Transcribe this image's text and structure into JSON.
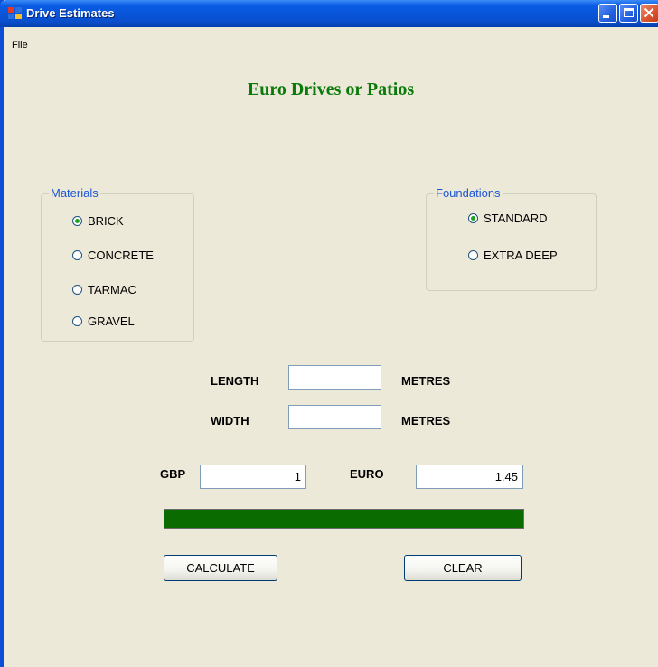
{
  "window": {
    "title": "Drive Estimates",
    "accent": "#0853d6"
  },
  "menu": {
    "file": "File"
  },
  "heading": "Euro Drives or Patios",
  "materials": {
    "legend": "Materials",
    "options": [
      "BRICK",
      "CONCRETE",
      "TARMAC",
      "GRAVEL"
    ],
    "selected": "BRICK"
  },
  "foundations": {
    "legend": "Foundations",
    "options": [
      "STANDARD",
      "EXTRA DEEP"
    ],
    "selected": "STANDARD"
  },
  "dimensions": {
    "length_label": "LENGTH",
    "length_value": "",
    "length_unit": "METRES",
    "width_label": "WIDTH",
    "width_value": "",
    "width_unit": "METRES"
  },
  "currency": {
    "gbp_label": "GBP",
    "gbp_value": "1",
    "euro_label": "EURO",
    "euro_value": "1.45"
  },
  "progress": {
    "value": 1.0,
    "color": "#0a6b00"
  },
  "buttons": {
    "calculate": "CALCULATE",
    "clear": "CLEAR"
  }
}
